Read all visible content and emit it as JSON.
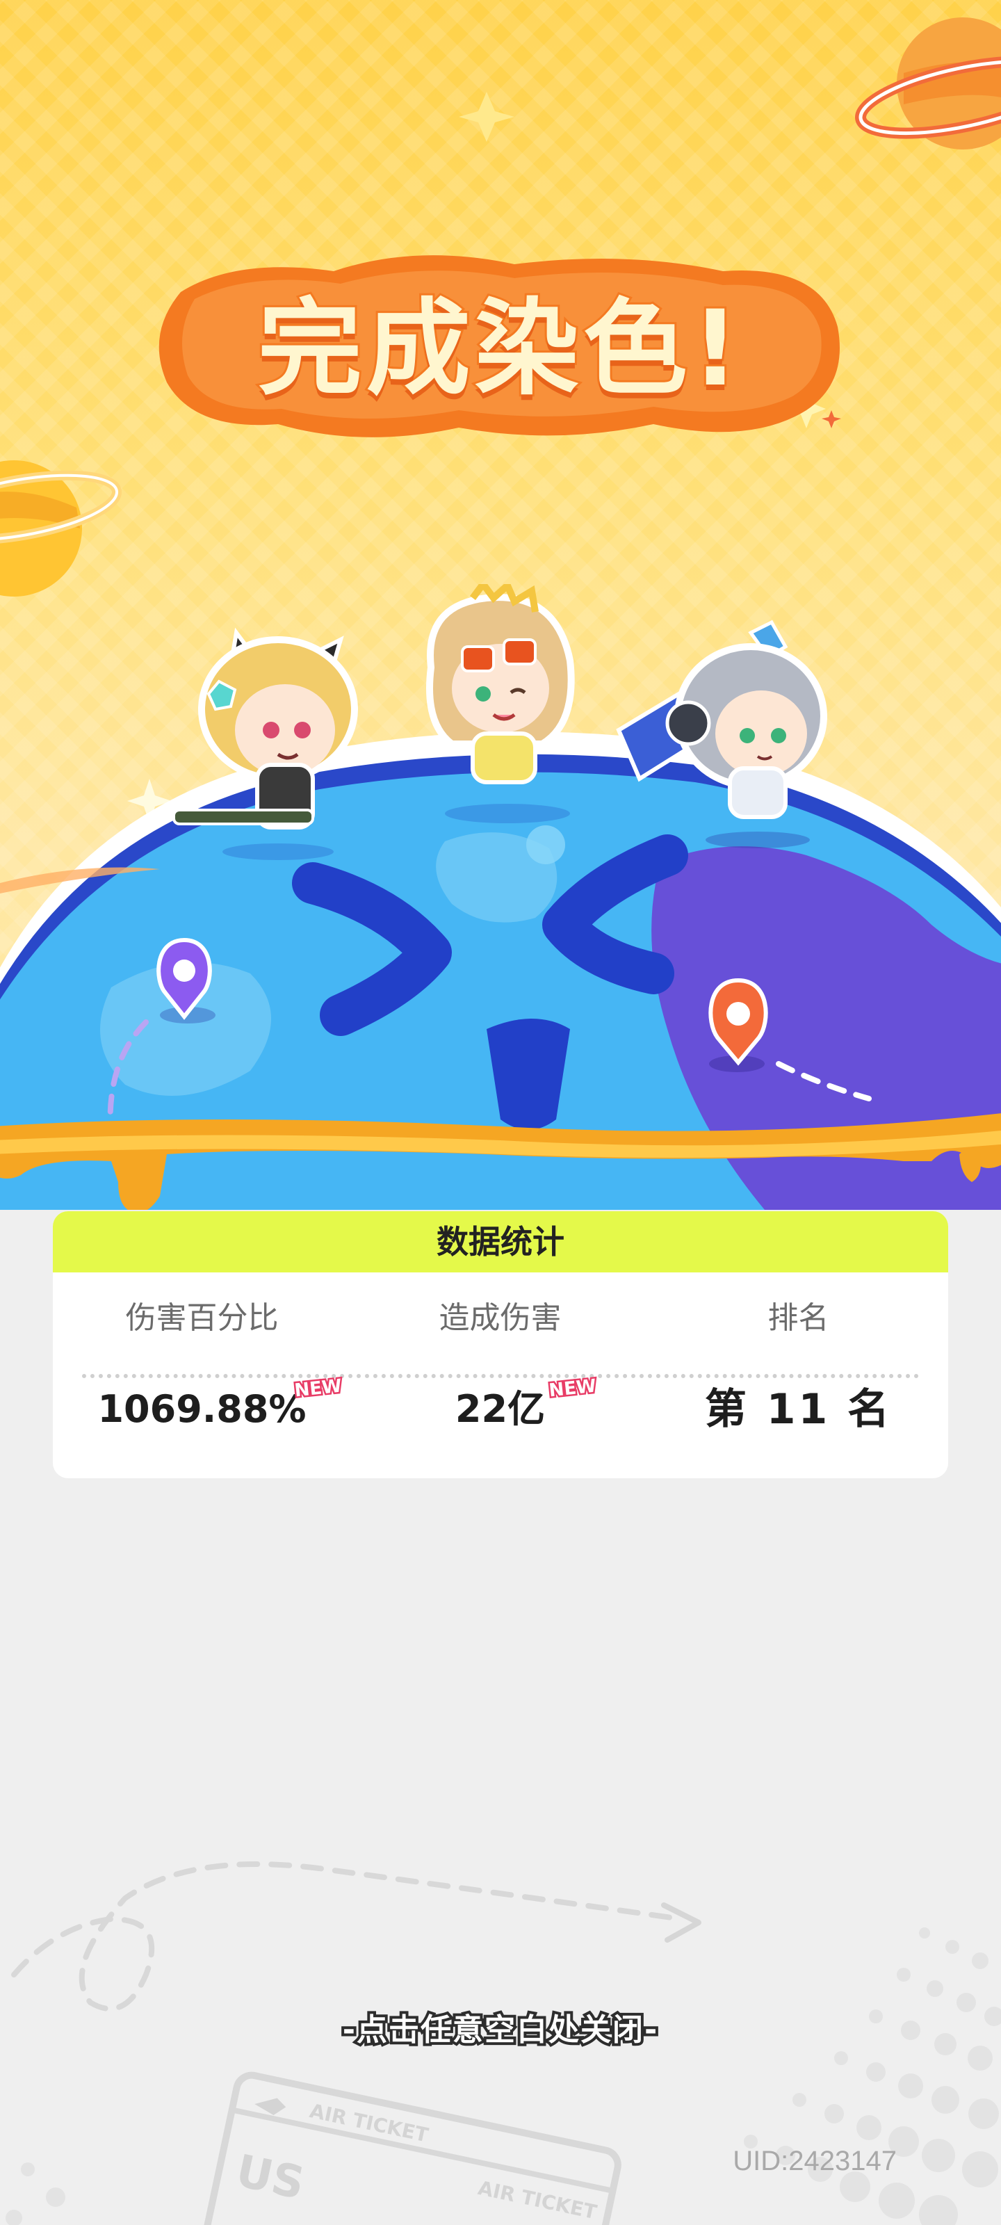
{
  "title": "完成染色!",
  "stats": {
    "header": "数据统计",
    "columns": [
      {
        "label": "伤害百分比",
        "value": "1069.88%",
        "is_new": true
      },
      {
        "label": "造成伤害",
        "value": "22亿",
        "is_new": true
      },
      {
        "label": "排名",
        "value": "第 11 名",
        "is_new": false
      }
    ],
    "new_badge_text": "NEW"
  },
  "close_hint": "-点击任意空白处关闭-",
  "uid": "UID:2423147",
  "ticket": {
    "label": "AIR TICKET",
    "code": "US"
  },
  "colors": {
    "background_top": "#ffd24a",
    "title_outline": "#f47a21",
    "globe_blue": "#44b4f3",
    "globe_dark_blue": "#2240c8",
    "globe_purple": "#6a4fd6",
    "drip_orange": "#f3a828",
    "stats_header_bg": "#e4f94a",
    "new_badge": "#e83c66",
    "page_bg": "#efefef"
  },
  "icons": [
    "sparkle-icon",
    "planet-icon",
    "map-pin-icon",
    "airplane-icon"
  ]
}
